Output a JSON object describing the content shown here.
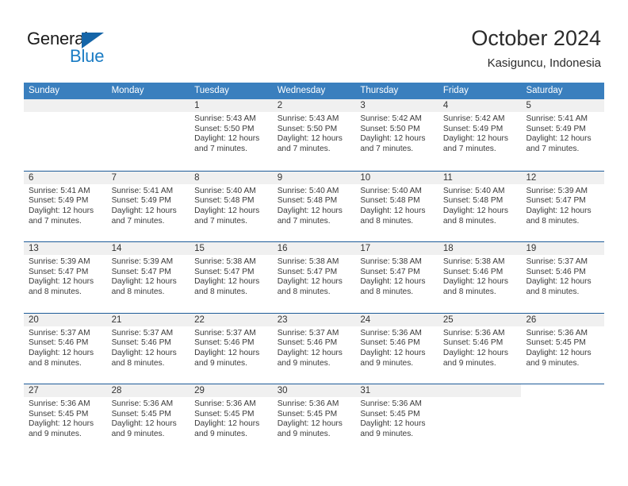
{
  "logo": {
    "word_top": "General",
    "word_bottom": "Blue",
    "triangle_icon": "triangle-icon",
    "color_dark": "#1a1a1a",
    "color_blue": "#1a7cc4"
  },
  "header": {
    "title": "October 2024",
    "subtitle": "Kasiguncu, Indonesia"
  },
  "theme": {
    "header_blue": "#3a7fbe",
    "rule_blue": "#1f5c99",
    "band_gray": "#f0f0f0",
    "text": "#333333"
  },
  "weekday_headers": [
    "Sunday",
    "Monday",
    "Tuesday",
    "Wednesday",
    "Thursday",
    "Friday",
    "Saturday"
  ],
  "weeks": [
    {
      "band": "full",
      "days": [
        {
          "num": "",
          "empty": true
        },
        {
          "num": "",
          "empty": true
        },
        {
          "num": "1",
          "sunrise": "Sunrise: 5:43 AM",
          "sunset": "Sunset: 5:50 PM",
          "daylight_line1": "Daylight: 12 hours",
          "daylight_line2": "and 7 minutes."
        },
        {
          "num": "2",
          "sunrise": "Sunrise: 5:43 AM",
          "sunset": "Sunset: 5:50 PM",
          "daylight_line1": "Daylight: 12 hours",
          "daylight_line2": "and 7 minutes."
        },
        {
          "num": "3",
          "sunrise": "Sunrise: 5:42 AM",
          "sunset": "Sunset: 5:50 PM",
          "daylight_line1": "Daylight: 12 hours",
          "daylight_line2": "and 7 minutes."
        },
        {
          "num": "4",
          "sunrise": "Sunrise: 5:42 AM",
          "sunset": "Sunset: 5:49 PM",
          "daylight_line1": "Daylight: 12 hours",
          "daylight_line2": "and 7 minutes."
        },
        {
          "num": "5",
          "sunrise": "Sunrise: 5:41 AM",
          "sunset": "Sunset: 5:49 PM",
          "daylight_line1": "Daylight: 12 hours",
          "daylight_line2": "and 7 minutes."
        }
      ]
    },
    {
      "band": "full",
      "days": [
        {
          "num": "6",
          "sunrise": "Sunrise: 5:41 AM",
          "sunset": "Sunset: 5:49 PM",
          "daylight_line1": "Daylight: 12 hours",
          "daylight_line2": "and 7 minutes."
        },
        {
          "num": "7",
          "sunrise": "Sunrise: 5:41 AM",
          "sunset": "Sunset: 5:49 PM",
          "daylight_line1": "Daylight: 12 hours",
          "daylight_line2": "and 7 minutes."
        },
        {
          "num": "8",
          "sunrise": "Sunrise: 5:40 AM",
          "sunset": "Sunset: 5:48 PM",
          "daylight_line1": "Daylight: 12 hours",
          "daylight_line2": "and 7 minutes."
        },
        {
          "num": "9",
          "sunrise": "Sunrise: 5:40 AM",
          "sunset": "Sunset: 5:48 PM",
          "daylight_line1": "Daylight: 12 hours",
          "daylight_line2": "and 7 minutes."
        },
        {
          "num": "10",
          "sunrise": "Sunrise: 5:40 AM",
          "sunset": "Sunset: 5:48 PM",
          "daylight_line1": "Daylight: 12 hours",
          "daylight_line2": "and 8 minutes."
        },
        {
          "num": "11",
          "sunrise": "Sunrise: 5:40 AM",
          "sunset": "Sunset: 5:48 PM",
          "daylight_line1": "Daylight: 12 hours",
          "daylight_line2": "and 8 minutes."
        },
        {
          "num": "12",
          "sunrise": "Sunrise: 5:39 AM",
          "sunset": "Sunset: 5:47 PM",
          "daylight_line1": "Daylight: 12 hours",
          "daylight_line2": "and 8 minutes."
        }
      ]
    },
    {
      "band": "full",
      "days": [
        {
          "num": "13",
          "sunrise": "Sunrise: 5:39 AM",
          "sunset": "Sunset: 5:47 PM",
          "daylight_line1": "Daylight: 12 hours",
          "daylight_line2": "and 8 minutes."
        },
        {
          "num": "14",
          "sunrise": "Sunrise: 5:39 AM",
          "sunset": "Sunset: 5:47 PM",
          "daylight_line1": "Daylight: 12 hours",
          "daylight_line2": "and 8 minutes."
        },
        {
          "num": "15",
          "sunrise": "Sunrise: 5:38 AM",
          "sunset": "Sunset: 5:47 PM",
          "daylight_line1": "Daylight: 12 hours",
          "daylight_line2": "and 8 minutes."
        },
        {
          "num": "16",
          "sunrise": "Sunrise: 5:38 AM",
          "sunset": "Sunset: 5:47 PM",
          "daylight_line1": "Daylight: 12 hours",
          "daylight_line2": "and 8 minutes."
        },
        {
          "num": "17",
          "sunrise": "Sunrise: 5:38 AM",
          "sunset": "Sunset: 5:47 PM",
          "daylight_line1": "Daylight: 12 hours",
          "daylight_line2": "and 8 minutes."
        },
        {
          "num": "18",
          "sunrise": "Sunrise: 5:38 AM",
          "sunset": "Sunset: 5:46 PM",
          "daylight_line1": "Daylight: 12 hours",
          "daylight_line2": "and 8 minutes."
        },
        {
          "num": "19",
          "sunrise": "Sunrise: 5:37 AM",
          "sunset": "Sunset: 5:46 PM",
          "daylight_line1": "Daylight: 12 hours",
          "daylight_line2": "and 8 minutes."
        }
      ]
    },
    {
      "band": "full",
      "days": [
        {
          "num": "20",
          "sunrise": "Sunrise: 5:37 AM",
          "sunset": "Sunset: 5:46 PM",
          "daylight_line1": "Daylight: 12 hours",
          "daylight_line2": "and 8 minutes."
        },
        {
          "num": "21",
          "sunrise": "Sunrise: 5:37 AM",
          "sunset": "Sunset: 5:46 PM",
          "daylight_line1": "Daylight: 12 hours",
          "daylight_line2": "and 8 minutes."
        },
        {
          "num": "22",
          "sunrise": "Sunrise: 5:37 AM",
          "sunset": "Sunset: 5:46 PM",
          "daylight_line1": "Daylight: 12 hours",
          "daylight_line2": "and 9 minutes."
        },
        {
          "num": "23",
          "sunrise": "Sunrise: 5:37 AM",
          "sunset": "Sunset: 5:46 PM",
          "daylight_line1": "Daylight: 12 hours",
          "daylight_line2": "and 9 minutes."
        },
        {
          "num": "24",
          "sunrise": "Sunrise: 5:36 AM",
          "sunset": "Sunset: 5:46 PM",
          "daylight_line1": "Daylight: 12 hours",
          "daylight_line2": "and 9 minutes."
        },
        {
          "num": "25",
          "sunrise": "Sunrise: 5:36 AM",
          "sunset": "Sunset: 5:46 PM",
          "daylight_line1": "Daylight: 12 hours",
          "daylight_line2": "and 9 minutes."
        },
        {
          "num": "26",
          "sunrise": "Sunrise: 5:36 AM",
          "sunset": "Sunset: 5:45 PM",
          "daylight_line1": "Daylight: 12 hours",
          "daylight_line2": "and 9 minutes."
        }
      ]
    },
    {
      "band": "partial",
      "days": [
        {
          "num": "27",
          "sunrise": "Sunrise: 5:36 AM",
          "sunset": "Sunset: 5:45 PM",
          "daylight_line1": "Daylight: 12 hours",
          "daylight_line2": "and 9 minutes."
        },
        {
          "num": "28",
          "sunrise": "Sunrise: 5:36 AM",
          "sunset": "Sunset: 5:45 PM",
          "daylight_line1": "Daylight: 12 hours",
          "daylight_line2": "and 9 minutes."
        },
        {
          "num": "29",
          "sunrise": "Sunrise: 5:36 AM",
          "sunset": "Sunset: 5:45 PM",
          "daylight_line1": "Daylight: 12 hours",
          "daylight_line2": "and 9 minutes."
        },
        {
          "num": "30",
          "sunrise": "Sunrise: 5:36 AM",
          "sunset": "Sunset: 5:45 PM",
          "daylight_line1": "Daylight: 12 hours",
          "daylight_line2": "and 9 minutes."
        },
        {
          "num": "31",
          "sunrise": "Sunrise: 5:36 AM",
          "sunset": "Sunset: 5:45 PM",
          "daylight_line1": "Daylight: 12 hours",
          "daylight_line2": "and 9 minutes."
        },
        {
          "num": "",
          "empty": true
        },
        {
          "num": "",
          "empty": true
        }
      ]
    }
  ]
}
